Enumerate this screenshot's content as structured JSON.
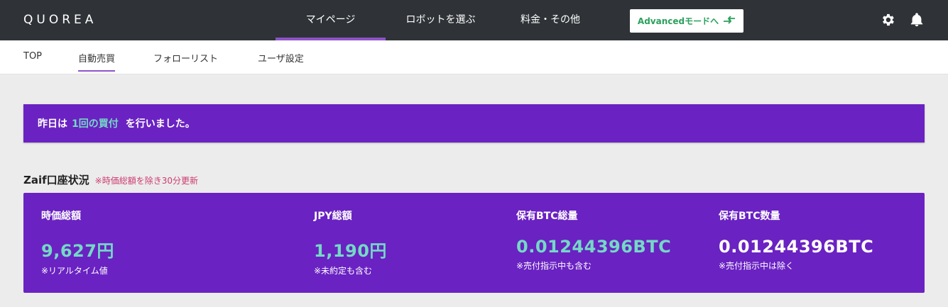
{
  "header": {
    "logo": "QUOREA",
    "nav": [
      {
        "label": "マイページ",
        "active": true
      },
      {
        "label": "ロボットを選ぶ",
        "active": false
      },
      {
        "label": "料金・その他",
        "active": false
      }
    ],
    "advanced_button": {
      "label": "Advancedモードへ",
      "icon": "swap-arrows-icon"
    },
    "icons": [
      "gear-icon",
      "bell-icon"
    ]
  },
  "subnav": [
    {
      "label": "TOP",
      "active": false
    },
    {
      "label": "自動売買",
      "active": true
    },
    {
      "label": "フォローリスト",
      "active": false
    },
    {
      "label": "ユーザ設定",
      "active": false
    }
  ],
  "notice": {
    "prefix": "昨日は",
    "highlight": "1回の買付",
    "suffix": "を行いました。"
  },
  "account": {
    "title": "Zaif口座状況",
    "note": "※時価総額を除き30分更新",
    "stats": [
      {
        "label": "時価総額",
        "value": "9,627円",
        "sub": "※リアルタイム値"
      },
      {
        "label": "JPY総額",
        "value": "1,190円",
        "sub": "※未約定も含む"
      },
      {
        "label": "保有BTC総量",
        "value": "0.01244396BTC",
        "sub": "※売付指示中も含む"
      },
      {
        "label": "保有BTC数量",
        "value": "0.01244396BTC",
        "sub": "※売付指示中は除く"
      }
    ]
  },
  "colors": {
    "topbar": "#2f3337",
    "accent_purple": "#6a22c2",
    "highlight_teal": "#74d9c5",
    "advanced_green": "#2aa05c",
    "note_pink": "#cc3b6f"
  }
}
